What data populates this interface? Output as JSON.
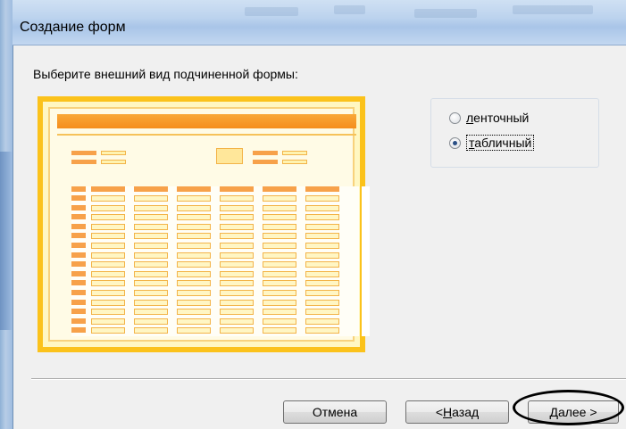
{
  "window": {
    "title": "Создание форм"
  },
  "prompt": {
    "text": "Выберите внешний вид подчиненной формы:"
  },
  "options": {
    "items": [
      {
        "label_accel": "л",
        "label_rest": "енточный",
        "selected": false
      },
      {
        "label_accel": "т",
        "label_rest": "абличный",
        "selected": true
      }
    ]
  },
  "buttons": {
    "cancel": {
      "label": "Отмена"
    },
    "back": {
      "prefix": "< ",
      "accel": "Н",
      "rest": "азад"
    },
    "next": {
      "accel": "Д",
      "rest": "алее >"
    }
  },
  "colors": {
    "preview_frame": "#fbc21b",
    "preview_accent": "#f7a14a",
    "annotation": "#000000"
  },
  "icons": {
    "option_control": "radio-icon"
  }
}
